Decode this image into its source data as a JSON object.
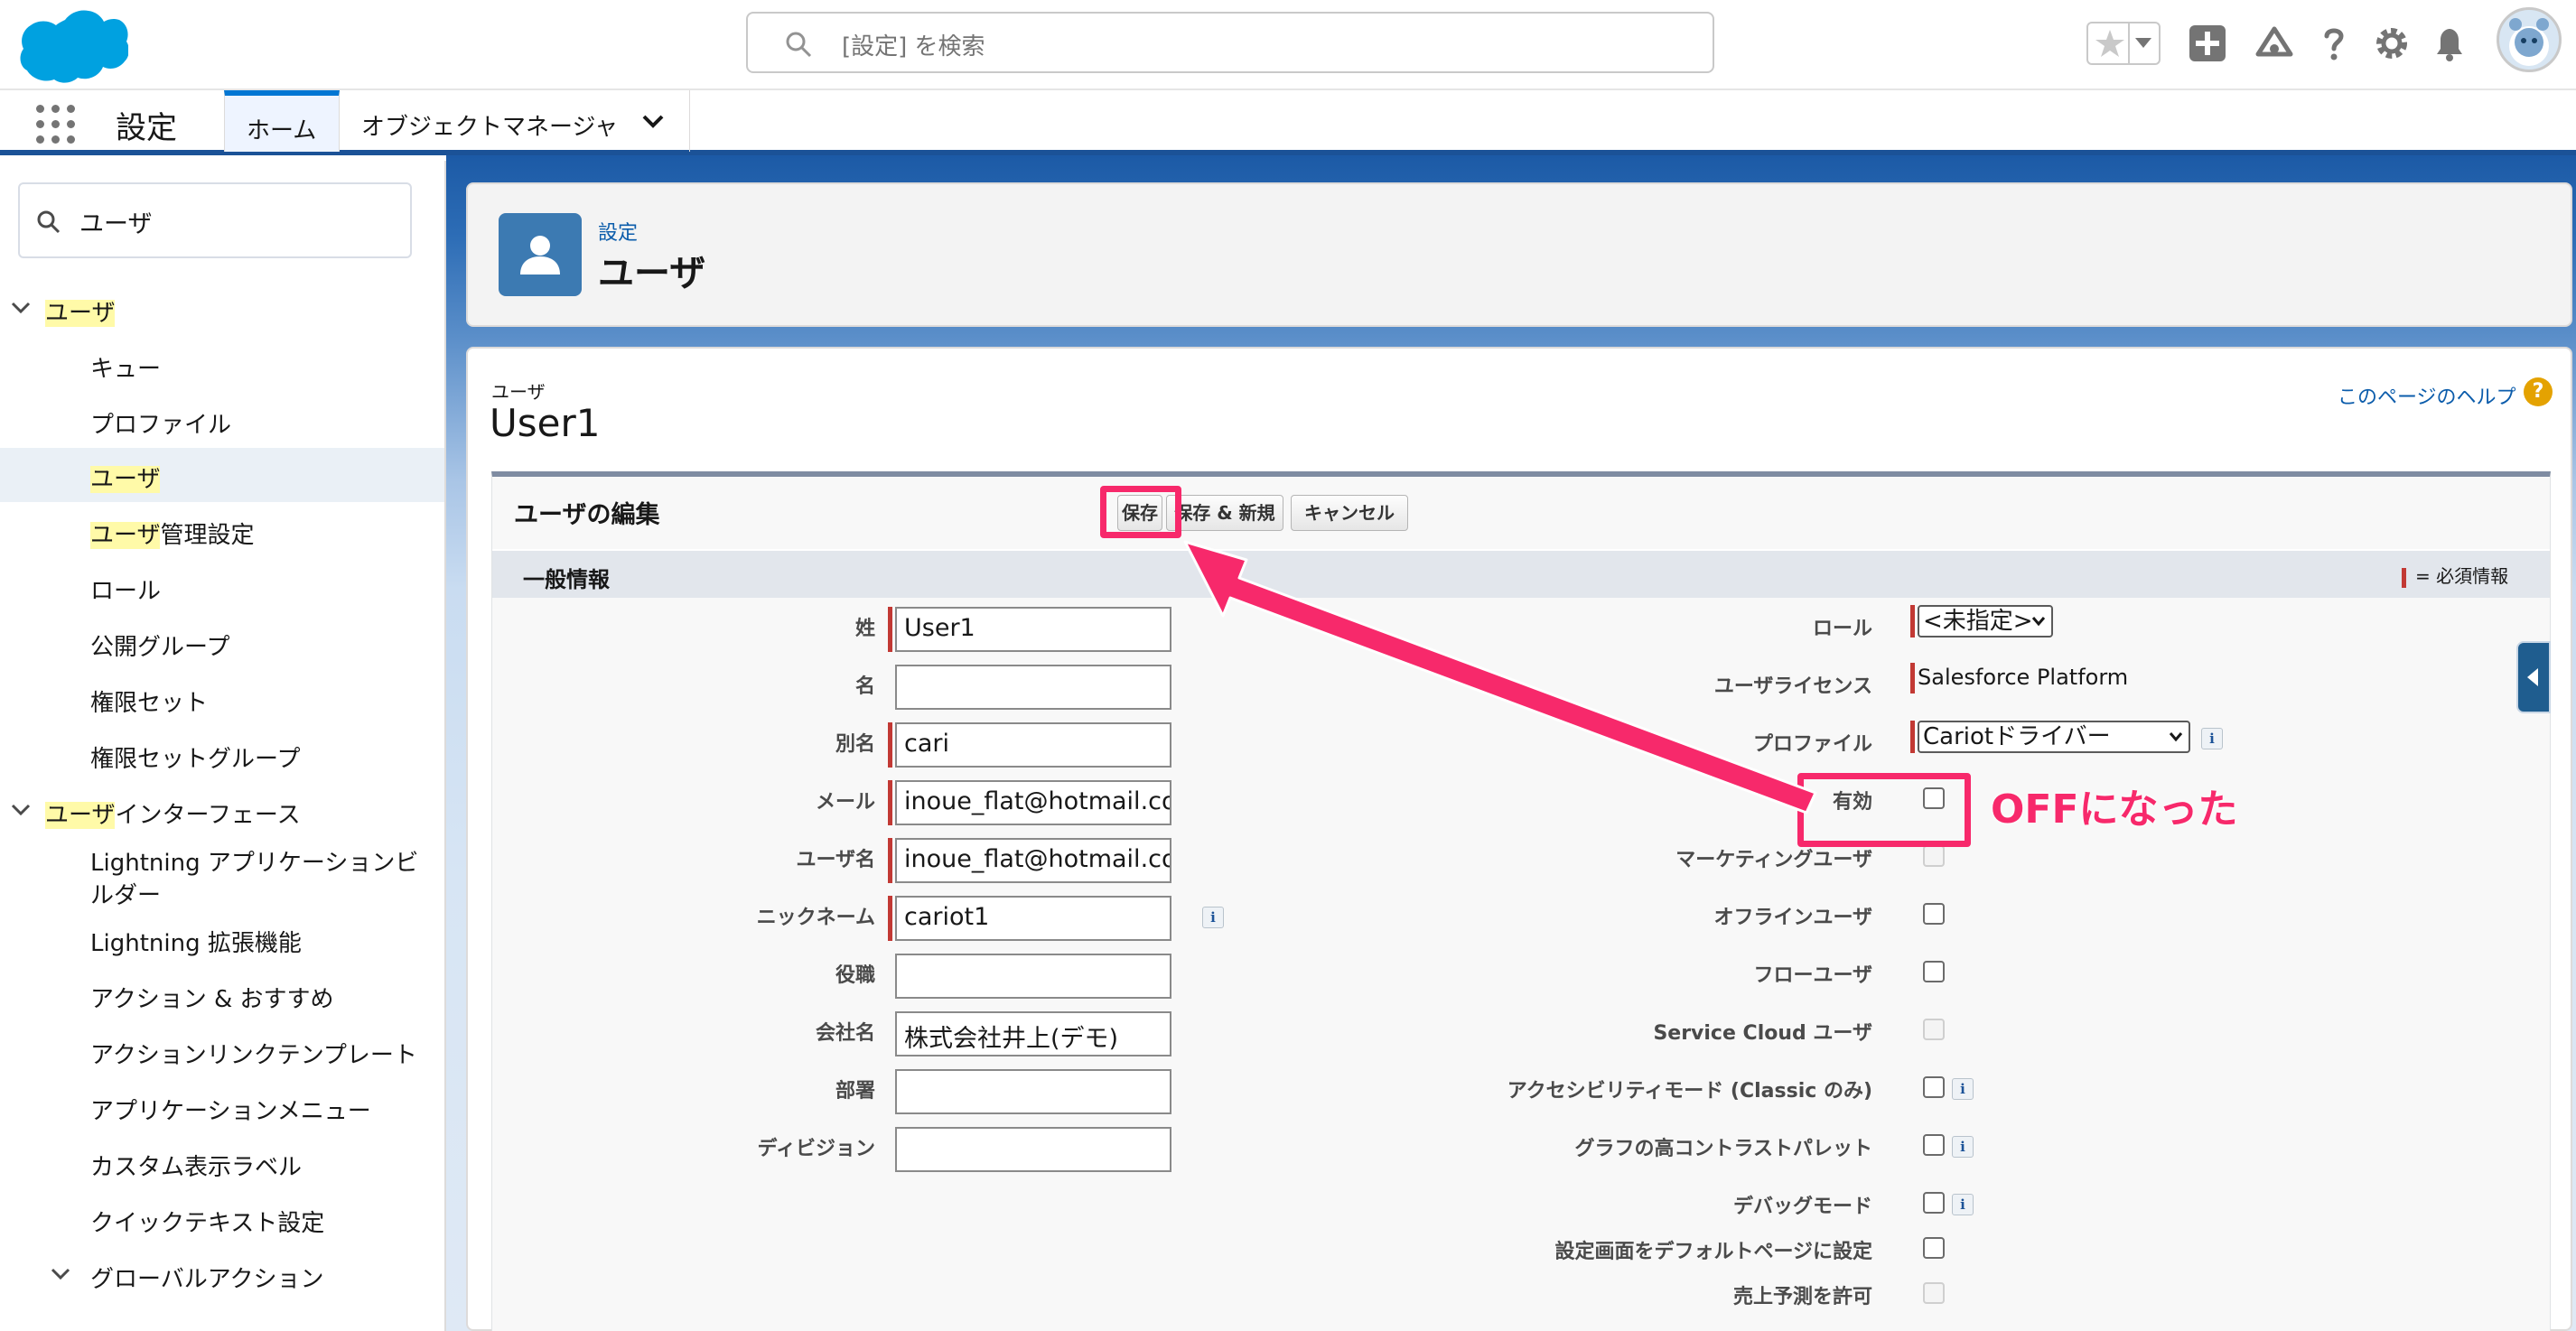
{
  "header": {
    "search_placeholder": "[設定] を検索"
  },
  "nav": {
    "app_name": "設定",
    "tabs": [
      "ホーム",
      "オブジェクトマネージャ"
    ]
  },
  "sidebar": {
    "quick_find_value": "ユーザ",
    "items": [
      {
        "pre": "",
        "hl": "ユーザ",
        "post": ""
      },
      {
        "label": "キュー"
      },
      {
        "label": "プロファイル"
      },
      {
        "pre": "",
        "hl": "ユーザ",
        "post": ""
      },
      {
        "pre": "",
        "hl": "ユーザ",
        "post": "管理設定"
      },
      {
        "label": "ロール"
      },
      {
        "label": "公開グループ"
      },
      {
        "label": "権限セット"
      },
      {
        "label": "権限セットグループ"
      },
      {
        "pre": "",
        "hl": "ユーザ",
        "post": "インターフェース"
      },
      {
        "label": "Lightning アプリケーションビルダー"
      },
      {
        "label": "Lightning 拡張機能"
      },
      {
        "label": "アクション & おすすめ"
      },
      {
        "label": "アクションリンクテンプレート"
      },
      {
        "label": "アプリケーションメニュー"
      },
      {
        "label": "カスタム表示ラベル"
      },
      {
        "label": "クイックテキスト設定"
      },
      {
        "label": "グローバルアクション"
      }
    ]
  },
  "page_header": {
    "breadcrumb": "設定",
    "title": "ユーザ"
  },
  "record": {
    "type_label": "ユーザ",
    "name": "User1",
    "help_link": "このページのヘルプ",
    "edit_title": "ユーザの編集",
    "buttons": {
      "save": "保存",
      "save_new": "保存 & 新規",
      "cancel": "キャンセル"
    },
    "section_title": "一般情報",
    "required_legend": "= 必須情報"
  },
  "left_fields": [
    {
      "label": "姓",
      "value": "User1"
    },
    {
      "label": "名",
      "value": ""
    },
    {
      "label": "別名",
      "value": "cari"
    },
    {
      "label": "メール",
      "value": "inoue_flat@hotmail.com"
    },
    {
      "label": "ユーザ名",
      "value": "inoue_flat@hotmail.com"
    },
    {
      "label": "ニックネーム",
      "value": "cariot1"
    },
    {
      "label": "役職",
      "value": ""
    },
    {
      "label": "会社名",
      "value": "株式会社井上(デモ)"
    },
    {
      "label": "部署",
      "value": ""
    },
    {
      "label": "ディビジョン",
      "value": ""
    }
  ],
  "right_fields": {
    "role": {
      "label": "ロール",
      "value": "<未指定>"
    },
    "license": {
      "label": "ユーザライセンス",
      "value": "Salesforce Platform"
    },
    "profile": {
      "label": "プロファイル",
      "value": "Cariotドライバー"
    },
    "checkboxes": [
      {
        "label": "有効",
        "checked": false
      },
      {
        "label": "マーケティングユーザ",
        "checked": false,
        "disabled": true
      },
      {
        "label": "オフラインユーザ",
        "checked": false
      },
      {
        "label": "フローユーザ",
        "checked": false
      },
      {
        "label": "Service Cloud ユーザ",
        "checked": false,
        "disabled": true
      },
      {
        "label": "アクセシビリティモード (Classic のみ)",
        "checked": false
      },
      {
        "label": "グラフの高コントラストパレット",
        "checked": false
      },
      {
        "label": "デバッグモード",
        "checked": false
      },
      {
        "label": "設定画面をデフォルトページに設定",
        "checked": false
      },
      {
        "label": "売上予測を許可",
        "checked": false,
        "disabled": true
      }
    ]
  },
  "annotation": {
    "callout": "OFFになった",
    "color": "#f7296b"
  },
  "colors": {
    "brand_blue": "#0176d3",
    "required_red": "#c23934",
    "highlight_yellow": "#fffaa8"
  }
}
